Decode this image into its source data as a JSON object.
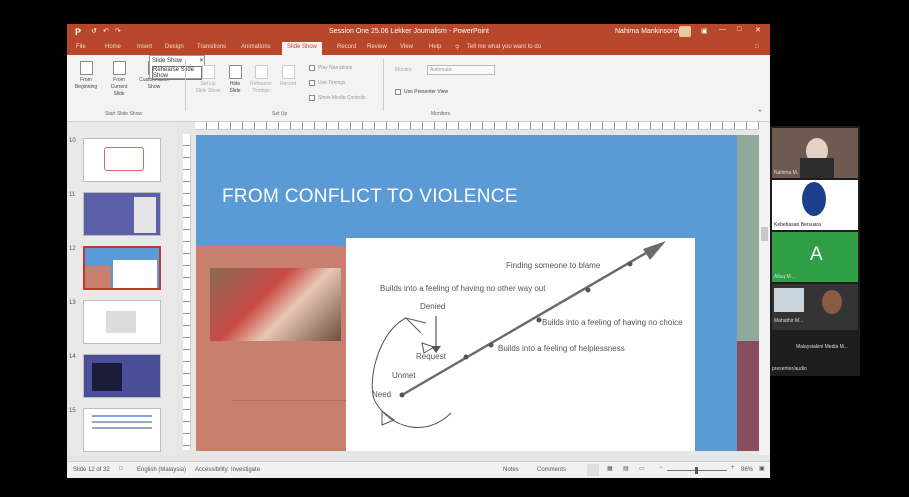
{
  "window": {
    "title": "Session One 25.06 Lekker Joumalism - PowerPoint",
    "user": "Nahima Mankinsorova"
  },
  "menu": {
    "tabs": [
      "File",
      "Home",
      "Insert",
      "Design",
      "Transitions",
      "Animations",
      "Slide Show",
      "Record",
      "Review",
      "View",
      "Help"
    ],
    "active_tab": "Slide Show",
    "tell_me": "Tell me what you want to do"
  },
  "ribbon": {
    "from_beginning": "From Beginning",
    "from_current": "From Current Slide",
    "custom_show": "Custom Slide Show",
    "dropdown": [
      "Slide Show",
      "Rehearse Slide Show"
    ],
    "setup_label": "Set Up Slide Show",
    "hide_slide": "Hide Slide",
    "rehearse": "Rehearse Timings",
    "record": "Record",
    "checks": [
      "Play Narrations",
      "Use Timings",
      "Show Media Controls"
    ],
    "group_start": "Start Slide Show",
    "group_setup": "Set Up",
    "monitor_label": "Monitor:",
    "monitor_value": "Automatic",
    "presenter_view": "Use Presenter View",
    "group_monitors": "Monitors"
  },
  "thumbnails": [
    {
      "num": "10"
    },
    {
      "num": "11"
    },
    {
      "num": "12"
    },
    {
      "num": "13"
    },
    {
      "num": "14"
    },
    {
      "num": "15"
    }
  ],
  "slide": {
    "title": "FROM CONFLICT TO VIOLENCE",
    "diagram": {
      "labels": [
        "Finding someone to blame",
        "Builds into a feeling of having  no other way out",
        "Builds into a feeling of having no choice",
        "Builds into a feeling of helplessness",
        "Denied",
        "Request",
        "Unmet",
        "Need"
      ]
    }
  },
  "status": {
    "slide": "Slide 12 of 32",
    "language": "English (Malaysia)",
    "accessibility": "Accessibility: Investigate",
    "notes": "Notes",
    "comments": "Comments",
    "zoom": "86%"
  },
  "participants": [
    {
      "name": "Nahima M."
    },
    {
      "name": "Kebebasan Bersuara"
    },
    {
      "name": "Alluq M..."
    },
    {
      "name": "Mahathir M..."
    },
    {
      "name": "Malaysiakini Media M..."
    }
  ],
  "gallery_footer": "presenter/audio",
  "colors": {
    "ppt_red": "#b7472a",
    "slide_blue": "#5b9bd5",
    "panel_rose": "#c97f6e",
    "band_green": "#8fa99b",
    "band_plum": "#8a4d5f",
    "avatar_green": "#2f9e44"
  }
}
